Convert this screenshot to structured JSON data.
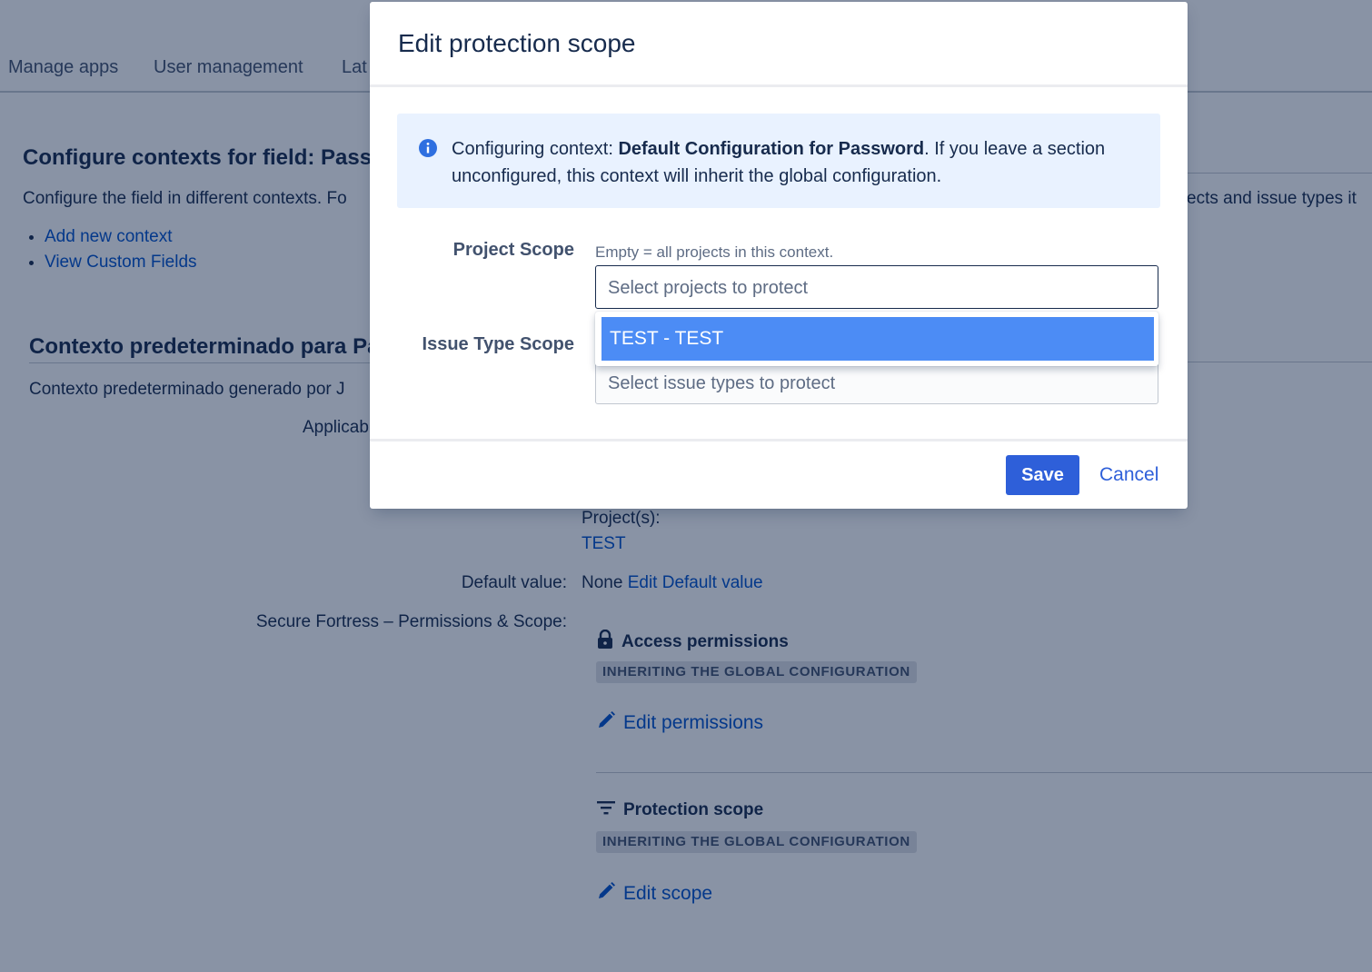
{
  "nav": {
    "items": [
      "Manage apps",
      "User management",
      "Lat"
    ]
  },
  "background": {
    "configure_heading": "Configure contexts for field: Passw",
    "configure_description": "Configure the field in different contexts. Fo",
    "configure_description_right": "ects and issue types it",
    "links": [
      "Add new context",
      "View Custom Fields"
    ],
    "context_heading": "Contexto predeterminado para Pa",
    "context_description": "Contexto predeterminado generado por J",
    "applicable_label": "Applicab",
    "projects_label": "Project(s):",
    "projects_value": "TEST",
    "default_value_label": "Default value:",
    "default_value": "None",
    "edit_default_link": "Edit Default value",
    "secure_label": "Secure Fortress – Permissions & Scope:",
    "access_title": "Access permissions",
    "access_lozenge": "INHERITING THE GLOBAL CONFIGURATION",
    "edit_permissions": "Edit permissions",
    "scope_title": "Protection scope",
    "scope_lozenge": "INHERITING THE GLOBAL CONFIGURATION",
    "edit_scope": "Edit scope"
  },
  "modal": {
    "title": "Edit protection scope",
    "info_prefix": "Configuring context: ",
    "info_bold": "Default Configuration for Password",
    "info_suffix": ". If you leave a section unconfigured, this context will inherit the global configuration.",
    "project_scope_label": "Project Scope",
    "project_scope_help": "Empty = all projects in this context.",
    "project_placeholder": "Select projects to protect",
    "dropdown_option": "TEST - TEST",
    "issue_type_label": "Issue Type Scope",
    "issue_type_placeholder": "Select issue types to protect",
    "save_label": "Save",
    "cancel_label": "Cancel"
  },
  "colors": {
    "primary": "#2e5fd9",
    "link": "#0052cc",
    "selected_option": "#4c8cf5",
    "info_background": "#e9f2ff",
    "overlay": "rgba(9,30,66,0.48)"
  },
  "icons": [
    "info-icon",
    "lock-icon",
    "pencil-icon",
    "filter-icon"
  ]
}
